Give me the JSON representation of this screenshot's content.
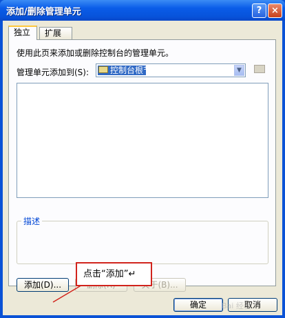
{
  "window": {
    "title": "添加/删除管理单元",
    "help": "?",
    "close": "×"
  },
  "tabs": [
    {
      "label": "独立"
    },
    {
      "label": "扩展"
    }
  ],
  "panel": {
    "description": "使用此页来添加或删除控制台的管理单元。",
    "add_to_label": "管理单元添加到(S):",
    "add_to_value": "控制台根节点",
    "group_label": "描述"
  },
  "buttons": {
    "add": "添加(D)...",
    "remove": "删除(R)",
    "about": "关于(B)...",
    "ok": "确定",
    "cancel": "取消"
  },
  "annotation": {
    "text": "点击“添加”↵"
  },
  "watermark": "Bai 经验"
}
